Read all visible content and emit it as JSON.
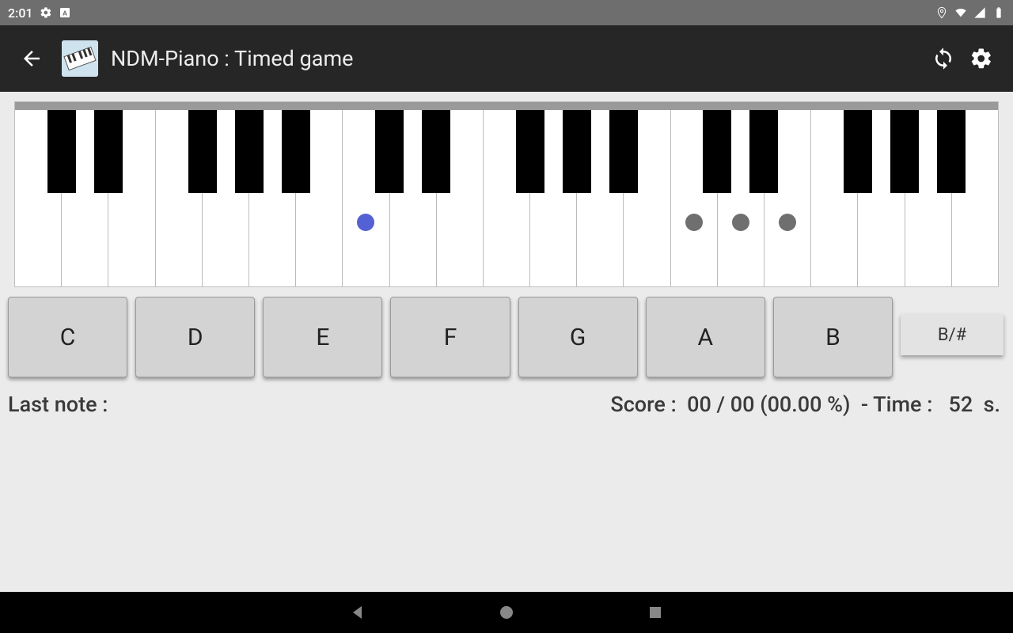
{
  "status_bar": {
    "time": "2:01",
    "left_icons": [
      "gear-icon",
      "language-icon"
    ],
    "right_icons": [
      "location-icon",
      "wifi-icon",
      "signal-icon",
      "battery-icon"
    ]
  },
  "header": {
    "title": "NDM-Piano : Timed game"
  },
  "piano": {
    "white_keys": 21,
    "black_key_pattern": [
      1,
      1,
      0,
      1,
      1,
      1,
      0
    ],
    "blue_marker_white_index": 7,
    "gray_marker_white_indices": [
      14,
      15,
      16
    ]
  },
  "note_buttons": [
    "C",
    "D",
    "E",
    "F",
    "G",
    "A",
    "B"
  ],
  "alt_button": "B/#",
  "status_line": {
    "last_note_label": "Last note :",
    "last_note_value": "",
    "score_label": "Score :",
    "score_correct": "00",
    "score_total": "00",
    "score_percent": "00.00 %",
    "time_label": "Time :",
    "time_value": "52",
    "time_unit": "s."
  },
  "navbar": [
    "back",
    "home",
    "recent"
  ]
}
